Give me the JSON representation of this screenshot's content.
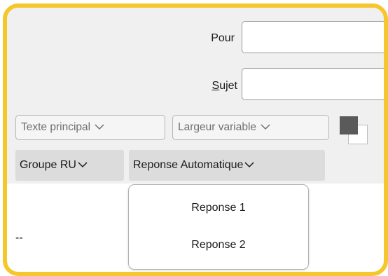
{
  "header": {
    "to_label": "Pour",
    "subject_label_accel": "S",
    "subject_label_rest": "ujet",
    "to_value": "",
    "subject_value": ""
  },
  "format_toolbar": {
    "text_style": "Texte principal",
    "width_mode": "Largeur variable",
    "color_icon": "text-color-icon"
  },
  "menu_bar": {
    "items": [
      {
        "label": "Groupe RU"
      },
      {
        "label": "Reponse Automatique"
      }
    ]
  },
  "popup_menu": {
    "items": [
      {
        "label": "Reponse 1"
      },
      {
        "label": "Reponse 2"
      }
    ]
  },
  "body": {
    "text": "--"
  },
  "colors": {
    "highlight_frame": "#f5c72c",
    "toolbar_bg": "#f0f0f0",
    "menu_button_bg": "#dcdcdc"
  }
}
